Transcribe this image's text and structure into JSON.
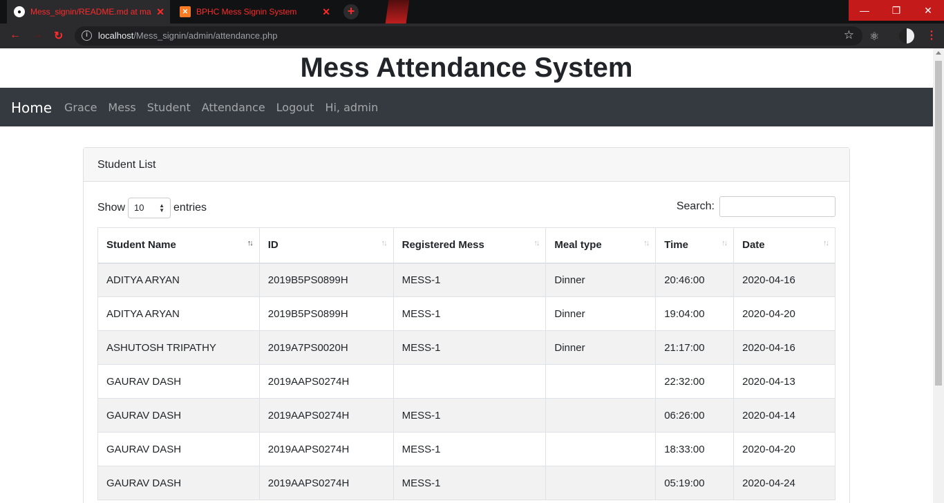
{
  "browser": {
    "tabs": [
      {
        "title": "Mess_signin/README.md at master"
      },
      {
        "title": "BPHC Mess Signin System"
      }
    ],
    "url_host": "localhost",
    "url_path": "/Mess_signin/admin/attendance.php"
  },
  "page": {
    "site_title": "Mess Attendance System",
    "brand": "Home",
    "nav": [
      "Grace",
      "Mess",
      "Student",
      "Attendance",
      "Logout",
      "Hi, admin"
    ],
    "card_title": "Student List",
    "show_label": "Show",
    "entries_value": "10",
    "entries_label": "entries",
    "search_label": "Search:",
    "columns": [
      "Student Name",
      "ID",
      "Registered Mess",
      "Meal type",
      "Time",
      "Date"
    ],
    "rows": [
      [
        "ADITYA ARYAN",
        "2019B5PS0899H",
        "MESS-1",
        "Dinner",
        "20:46:00",
        "2020-04-16"
      ],
      [
        "ADITYA ARYAN",
        "2019B5PS0899H",
        "MESS-1",
        "Dinner",
        "19:04:00",
        "2020-04-20"
      ],
      [
        "ASHUTOSH TRIPATHY",
        "2019A7PS0020H",
        "MESS-1",
        "Dinner",
        "21:17:00",
        "2020-04-16"
      ],
      [
        "GAURAV DASH",
        "2019AAPS0274H",
        "",
        "",
        "22:32:00",
        "2020-04-13"
      ],
      [
        "GAURAV DASH",
        "2019AAPS0274H",
        "MESS-1",
        "",
        "06:26:00",
        "2020-04-14"
      ],
      [
        "GAURAV DASH",
        "2019AAPS0274H",
        "MESS-1",
        "",
        "18:33:00",
        "2020-04-20"
      ],
      [
        "GAURAV DASH",
        "2019AAPS0274H",
        "MESS-1",
        "",
        "05:19:00",
        "2020-04-24"
      ]
    ]
  }
}
